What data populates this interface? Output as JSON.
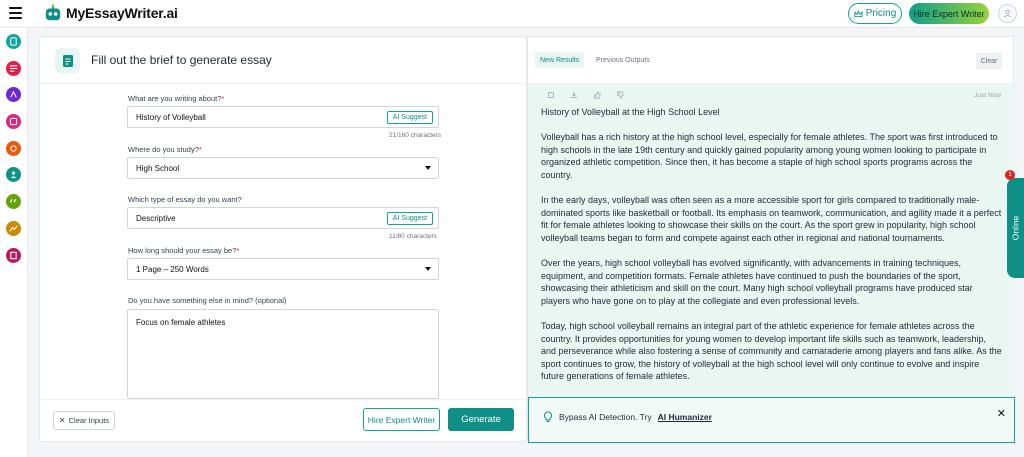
{
  "header": {
    "brand": "MyEssayWriter.ai",
    "pricing_label": "Pricing",
    "hire_label": "Hire Expert Writer"
  },
  "sidebar": {
    "items": [
      {
        "name": "doc-tool-icon",
        "color": "#14a39a"
      },
      {
        "name": "text-lines-icon",
        "color": "#e11d48"
      },
      {
        "name": "ai-writer-icon",
        "color": "#6d28d9"
      },
      {
        "name": "image-tool-icon",
        "color": "#db2777"
      },
      {
        "name": "network-icon",
        "color": "#ea580c"
      },
      {
        "name": "person-icon",
        "color": "#0d9488"
      },
      {
        "name": "quote-icon",
        "color": "#65a30d"
      },
      {
        "name": "chart-icon",
        "color": "#ca8a04"
      },
      {
        "name": "book-icon",
        "color": "#be185d"
      }
    ]
  },
  "brief": {
    "title": "Fill out the brief to generate essay",
    "topic": {
      "label": "What are you writing about?",
      "value": "History of Volleyball",
      "suggest": "AI Suggest",
      "counter": "21/160 characters"
    },
    "study": {
      "label": "Where do you study?",
      "value": "High School"
    },
    "type": {
      "label": "Which type of essay do you want?",
      "value": "Descriptive",
      "suggest": "AI Suggest",
      "counter": "11/80 characters"
    },
    "length": {
      "label": "How long should your essay be?",
      "value": "1 Page – 250 Words"
    },
    "extra": {
      "label": "Do you have something else in mind? (optional)",
      "value": "Focus on female athletes"
    },
    "clear_label": "Clear Inputs",
    "hire_label": "Hire Expert Writer",
    "generate_label": "Generate"
  },
  "results": {
    "tab_new": "New Results",
    "tab_previous": "Previous Outputs",
    "clear_label": "Clear",
    "timestamp": "Just Now",
    "essay_title": "History of Volleyball at the High School Level",
    "paragraphs": [
      "Volleyball has a rich history at the high school level, especially for female athletes. The sport was first introduced to high schools in the late 19th century and quickly gained popularity among young women looking to participate in organized athletic competition. Since then, it has become a staple of high school sports programs across the country.",
      "In the early days, volleyball was often seen as a more accessible sport for girls compared to traditionally male-dominated sports like basketball or football. Its emphasis on teamwork, communication, and agility made it a perfect fit for female athletes looking to showcase their skills on the court. As the sport grew in popularity, high school volleyball teams began to form and compete against each other in regional and national tournaments.",
      "Over the years, high school volleyball has evolved significantly, with advancements in training techniques, equipment, and competition formats. Female athletes have continued to push the boundaries of the sport, showcasing their athleticism and skill on the court. Many high school volleyball programs have produced star players who have gone on to play at the collegiate and even professional levels.",
      "Today, high school volleyball remains an integral part of the athletic experience for female athletes across the country. It provides opportunities for young women to develop important life skills such as teamwork, leadership, and perseverance while also fostering a sense of community and camaraderie among players and fans alike. As the sport continues to grow, the history of volleyball at the high school level will only continue to evolve and inspire future generations of female athletes."
    ]
  },
  "bypass": {
    "text": "Bypass AI Detection. Try",
    "link": "AI Humanizer"
  },
  "chat": {
    "label": "Online",
    "badge": "1"
  },
  "colors": {
    "accent": "#0f8f86",
    "result_bg": "#eaf6f1"
  }
}
